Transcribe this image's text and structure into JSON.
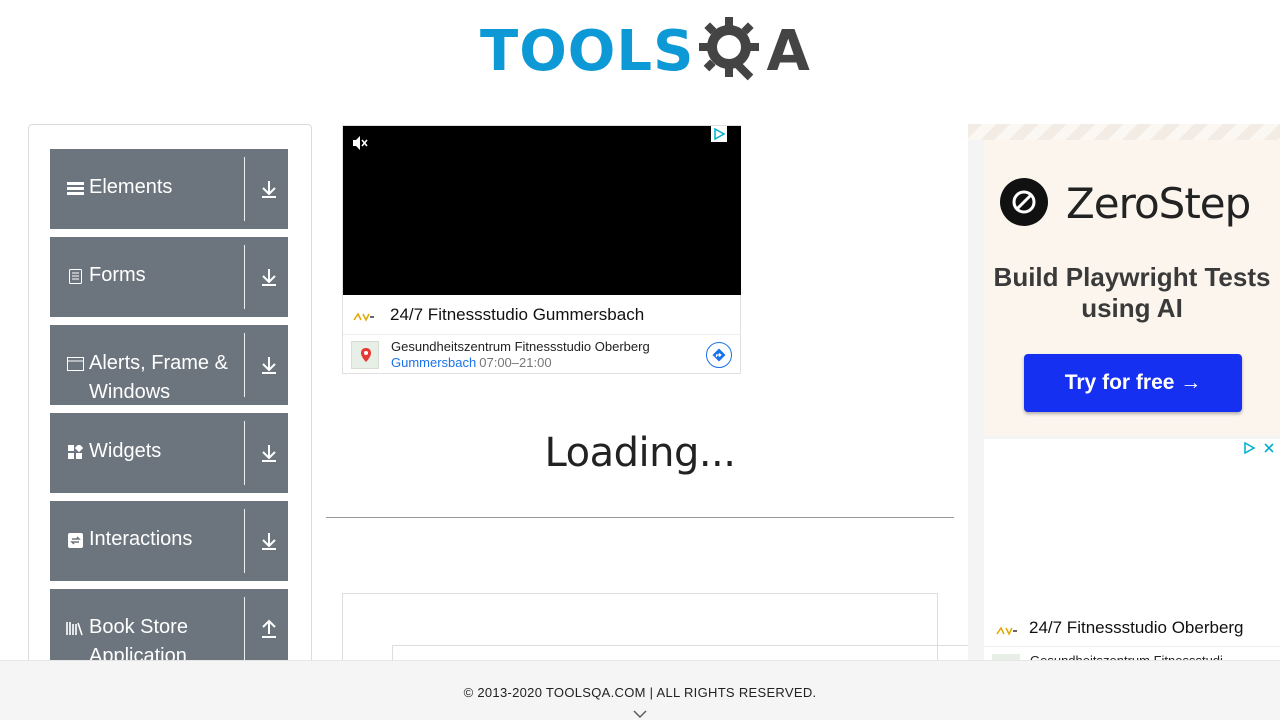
{
  "header": {
    "logo_main": "TOOLS",
    "logo_accent": "A"
  },
  "sidebar": {
    "groups": [
      {
        "label": "Elements",
        "icon": "menu-icon",
        "toggle": "download-icon"
      },
      {
        "label": "Forms",
        "icon": "document-icon",
        "toggle": "download-icon"
      },
      {
        "label": "Alerts, Frame & Windows",
        "icon": "window-icon",
        "toggle": "download-icon"
      },
      {
        "label": "Widgets",
        "icon": "widgets-icon",
        "toggle": "download-icon"
      },
      {
        "label": "Interactions",
        "icon": "interactions-icon",
        "toggle": "download-icon"
      },
      {
        "label": "Book Store Application",
        "icon": "books-icon",
        "toggle": "upload-icon"
      }
    ]
  },
  "ad_center": {
    "headline": "24/7 Fitnessstudio Gummersbach",
    "sub_title": "Gesundheitszentrum Fitnessstudio Oberberg",
    "location": "Gummersbach",
    "hours": "07:00–21:00"
  },
  "main": {
    "loading_text": "Loading..."
  },
  "ad_right": {
    "brand": "ZeroStep",
    "tagline": "Build Playwright Tests using AI",
    "cta": "Try for free →",
    "ad2_headline": "24/7 Fitnessstudio Oberberg",
    "ad2_sub": "Gesundheitszentrum Fitnessstudi"
  },
  "footer": {
    "copyright": "© 2013-2020 TOOLSQA.COM | ALL RIGHTS RESERVED."
  },
  "colors": {
    "brand_blue": "#0d99d6",
    "sidebar_group_bg": "#6c757d",
    "cta_blue": "#1530f0",
    "link_blue": "#1a73e8"
  }
}
